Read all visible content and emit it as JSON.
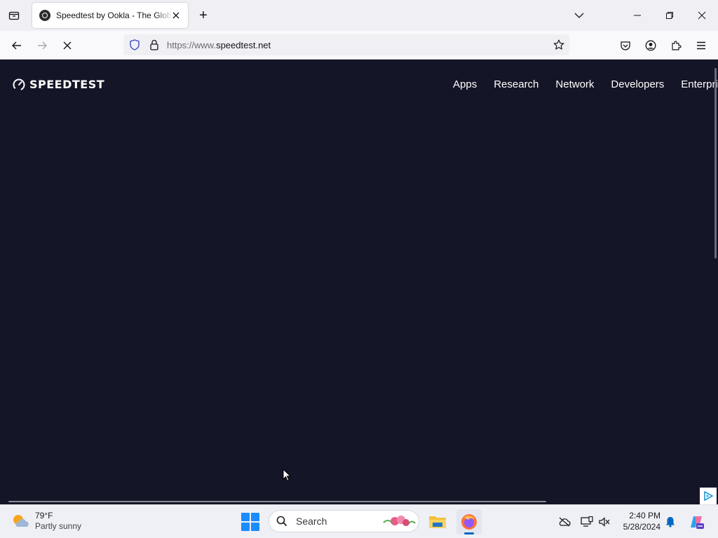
{
  "browser": {
    "tab": {
      "title": "Speedtest by Ookla - The Global Broadband Speed Test"
    },
    "new_tab_symbol": "+",
    "url": {
      "scheme": "https://www.",
      "host": "speedtest.net"
    },
    "icons": [
      "tab-list-icon",
      "close-icon",
      "plus-icon",
      "chevron-down-icon",
      "minimize-icon",
      "restore-icon",
      "window-close-icon",
      "back-arrow-icon",
      "forward-arrow-icon",
      "loading-icon",
      "shield-icon",
      "lock-icon",
      "star-icon",
      "pocket-icon",
      "account-icon",
      "extensions-icon",
      "menu-icon"
    ]
  },
  "page": {
    "logo_text": "SPEEDTEST",
    "nav": [
      {
        "label": "Apps"
      },
      {
        "label": "Research"
      },
      {
        "label": "Network"
      },
      {
        "label": "Developers"
      },
      {
        "label": "Enterprise"
      }
    ],
    "background_color": "#141526"
  },
  "taskbar": {
    "weather": {
      "temp": "79°F",
      "condition": "Partly sunny"
    },
    "search_label": "Search",
    "clock": {
      "time": "2:40 PM",
      "date": "5/28/2024"
    },
    "accent_color": "#0067c0"
  }
}
